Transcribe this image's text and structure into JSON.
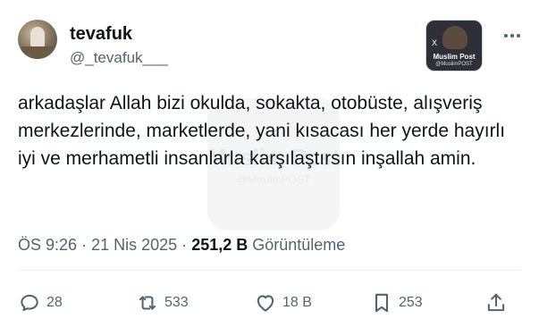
{
  "author": {
    "display_name": "tevafuk",
    "handle": "@_tevafuk___",
    "avatar_icon": "profile-photo"
  },
  "attached_badge": {
    "title": "Muslim Post",
    "handle": "@MuslimPOST",
    "x_mark": "X"
  },
  "watermark": {
    "text": "Muslim Post",
    "sub": "@MuslimPOST"
  },
  "tweet": {
    "text": "arkadaşlar Allah bizi okulda, sokakta, otobüste, alışveriş merkezlerinde, marketlerde, yani kısacası her yerde hayırlı iyi ve merhametli insanlarla karşılaştırsın inşallah amin."
  },
  "meta": {
    "time": "ÖS 9:26",
    "separator": "·",
    "date": "21 Nis 2025",
    "views_count": "251,2 B",
    "views_label": "Görüntüleme"
  },
  "actions": {
    "replies": "28",
    "reposts": "533",
    "likes": "18 B",
    "bookmarks": "253"
  },
  "colors": {
    "text": "#0f1419",
    "secondary": "#536471",
    "divider": "#eff3f4"
  }
}
